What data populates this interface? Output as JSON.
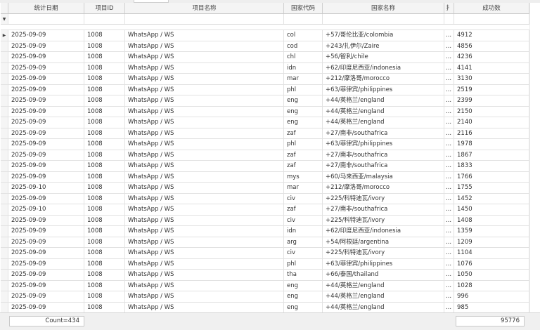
{
  "columns": [
    "统计日期",
    "项目ID",
    "项目名称",
    "国家代码",
    "国家名称",
    "扌",
    "成功数"
  ],
  "filter_icon": "filter-icon",
  "row_indicator": "current-row-arrow-icon",
  "rows": [
    [
      "2025-09-09",
      "1008",
      "WhatsApp / WS",
      "col",
      "+57/哥伦比亚/colombia",
      "...",
      "4912"
    ],
    [
      "2025-09-09",
      "1008",
      "WhatsApp / WS",
      "cod",
      "+243/扎伊尔/Zaire",
      "...",
      "4856"
    ],
    [
      "2025-09-09",
      "1008",
      "WhatsApp / WS",
      "chl",
      "+56/智利/chile",
      "...",
      "4236"
    ],
    [
      "2025-09-09",
      "1008",
      "WhatsApp / WS",
      "idn",
      "+62/印度尼西亚/indonesia",
      "...",
      "4141"
    ],
    [
      "2025-09-09",
      "1008",
      "WhatsApp / WS",
      "mar",
      "+212/摩洛哥/morocco",
      "...",
      "3130"
    ],
    [
      "2025-09-09",
      "1008",
      "WhatsApp / WS",
      "phl",
      "+63/菲律宾/philippines",
      "...",
      "2519"
    ],
    [
      "2025-09-09",
      "1008",
      "WhatsApp / WS",
      "eng",
      "+44/英格兰/england",
      "...",
      "2399"
    ],
    [
      "2025-09-09",
      "1008",
      "WhatsApp / WS",
      "eng",
      "+44/英格兰/england",
      "...",
      "2150"
    ],
    [
      "2025-09-09",
      "1008",
      "WhatsApp / WS",
      "eng",
      "+44/英格兰/england",
      "...",
      "2140"
    ],
    [
      "2025-09-09",
      "1008",
      "WhatsApp / WS",
      "zaf",
      "+27/南非/southafrica",
      "...",
      "2116"
    ],
    [
      "2025-09-09",
      "1008",
      "WhatsApp / WS",
      "phl",
      "+63/菲律宾/philippines",
      "...",
      "1978"
    ],
    [
      "2025-09-09",
      "1008",
      "WhatsApp / WS",
      "zaf",
      "+27/南非/southafrica",
      "...",
      "1867"
    ],
    [
      "2025-09-09",
      "1008",
      "WhatsApp / WS",
      "zaf",
      "+27/南非/southafrica",
      "...",
      "1833"
    ],
    [
      "2025-09-09",
      "1008",
      "WhatsApp / WS",
      "mys",
      "+60/马来西亚/malaysia",
      "...",
      "1766"
    ],
    [
      "2025-09-10",
      "1008",
      "WhatsApp / WS",
      "mar",
      "+212/摩洛哥/morocco",
      "...",
      "1755"
    ],
    [
      "2025-09-09",
      "1008",
      "WhatsApp / WS",
      "civ",
      "+225/科特迪瓦/ivory",
      "...",
      "1452"
    ],
    [
      "2025-09-10",
      "1008",
      "WhatsApp / WS",
      "zaf",
      "+27/南非/southafrica",
      "...",
      "1450"
    ],
    [
      "2025-09-09",
      "1008",
      "WhatsApp / WS",
      "civ",
      "+225/科特迪瓦/ivory",
      "...",
      "1408"
    ],
    [
      "2025-09-09",
      "1008",
      "WhatsApp / WS",
      "idn",
      "+62/印度尼西亚/indonesia",
      "...",
      "1359"
    ],
    [
      "2025-09-09",
      "1008",
      "WhatsApp / WS",
      "arg",
      "+54/阿根廷/argentina",
      "...",
      "1209"
    ],
    [
      "2025-09-09",
      "1008",
      "WhatsApp / WS",
      "civ",
      "+225/科特迪瓦/ivory",
      "...",
      "1104"
    ],
    [
      "2025-09-09",
      "1008",
      "WhatsApp / WS",
      "phl",
      "+63/菲律宾/philippines",
      "...",
      "1076"
    ],
    [
      "2025-09-09",
      "1008",
      "WhatsApp / WS",
      "tha",
      "+66/泰国/thailand",
      "...",
      "1050"
    ],
    [
      "2025-09-09",
      "1008",
      "WhatsApp / WS",
      "eng",
      "+44/英格兰/england",
      "...",
      "1028"
    ],
    [
      "2025-09-09",
      "1008",
      "WhatsApp / WS",
      "eng",
      "+44/英格兰/england",
      "...",
      "996"
    ],
    [
      "2025-09-09",
      "1008",
      "WhatsApp / WS",
      "eng",
      "+44/英格兰/england",
      "...",
      "985"
    ]
  ],
  "footer": {
    "count": "Count=434",
    "total": "95776"
  }
}
